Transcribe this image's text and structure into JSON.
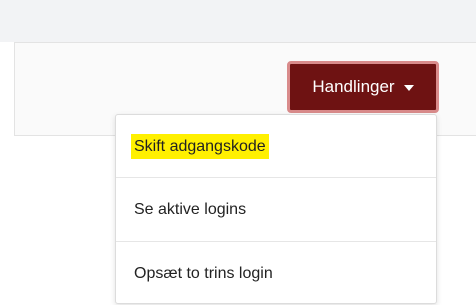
{
  "actions": {
    "label": "Handlinger"
  },
  "menu": {
    "items": [
      {
        "label": "Skift adgangskode",
        "highlighted": true
      },
      {
        "label": "Se aktive logins",
        "highlighted": false
      },
      {
        "label": "Opsæt to trins login",
        "highlighted": false
      }
    ]
  },
  "colors": {
    "button_background": "#6e1212",
    "button_border": "#d98b8b",
    "highlight": "#fff000"
  }
}
